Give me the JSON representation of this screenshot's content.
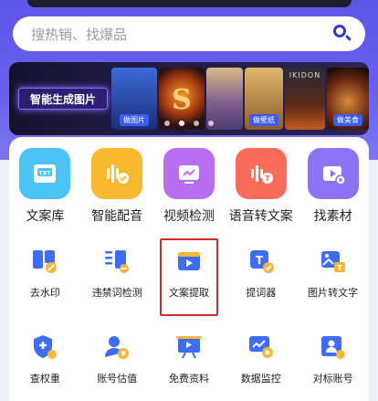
{
  "search": {
    "placeholder": "搜热销、找爆品"
  },
  "banner": {
    "title": "智能生成图片",
    "thumbs": [
      {
        "tag": "做图片"
      },
      {
        "tag": ""
      },
      {
        "tag": ""
      },
      {
        "tag": "做壁纸"
      },
      {
        "tag": "IKIDON"
      },
      {
        "tag": "做美食"
      }
    ]
  },
  "main_tools": [
    {
      "label": "文案库",
      "icon": "txt-file-icon",
      "color": "#4cc3f5"
    },
    {
      "label": "智能配音",
      "icon": "voice-dub-icon",
      "color": "#f8b830"
    },
    {
      "label": "视频检测",
      "icon": "video-check-icon",
      "color": "#b76ef0"
    },
    {
      "label": "语音转文案",
      "icon": "speech-to-text-icon",
      "color": "#fb6d5a"
    },
    {
      "label": "找素材",
      "icon": "find-material-icon",
      "color": "#8c72f6"
    }
  ],
  "tools_row2": [
    {
      "label": "去水印",
      "icon": "watermark-remove-icon"
    },
    {
      "label": "违禁词检测",
      "icon": "banned-word-icon"
    },
    {
      "label": "文案提取",
      "icon": "copy-extract-icon"
    },
    {
      "label": "提词器",
      "icon": "teleprompter-icon"
    },
    {
      "label": "图片转文字",
      "icon": "image-to-text-icon"
    }
  ],
  "tools_row3": [
    {
      "label": "查权重",
      "icon": "weight-check-icon"
    },
    {
      "label": "账号估值",
      "icon": "account-value-icon"
    },
    {
      "label": "免费资料",
      "icon": "free-resource-icon"
    },
    {
      "label": "数据监控",
      "icon": "data-monitor-icon"
    },
    {
      "label": "对标账号",
      "icon": "benchmark-account-icon"
    }
  ],
  "highlight_color": "#d9262b",
  "accent": "#5b54e6"
}
